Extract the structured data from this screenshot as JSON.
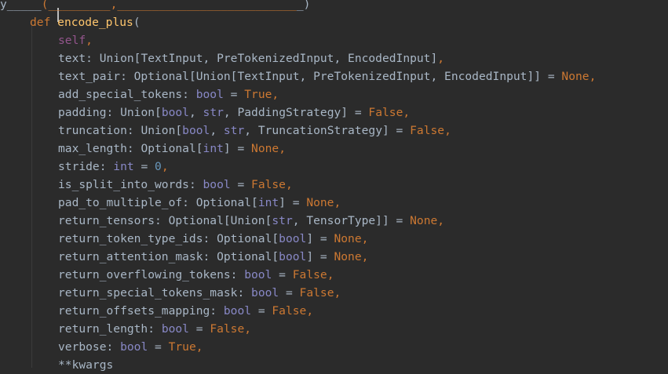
{
  "colors": {
    "background": "#2b2b2b",
    "text": "#a9b7c6",
    "keyword": "#cc7832",
    "function_name": "#ffc66d",
    "self": "#94558d",
    "builtin": "#8888c6",
    "number": "#6897bb"
  },
  "editor": {
    "lines": [
      {
        "indent": 0,
        "tokens": [
          [
            "y_____",
            ""
          ],
          [
            "(_________,",
            "t-kw"
          ],
          [
            "__________________________",
            "t-kw"
          ],
          [
            "_)",
            "t-punct"
          ]
        ]
      },
      {
        "indent": 1,
        "tokens": [
          [
            "def",
            "t-kw"
          ],
          [
            " ",
            ""
          ],
          [
            "encode_plus",
            "t-fn"
          ],
          [
            "(",
            "t-punct"
          ]
        ]
      },
      {
        "indent": 2,
        "tokens": [
          [
            "self",
            "t-self"
          ],
          [
            ",",
            "t-comma"
          ]
        ]
      },
      {
        "indent": 2,
        "tokens": [
          [
            "text",
            ""
          ],
          [
            ": Union[TextInput, PreTokenizedInput, EncodedInput]",
            ""
          ],
          [
            ",",
            "t-comma"
          ]
        ]
      },
      {
        "indent": 2,
        "tokens": [
          [
            "text_pair",
            ""
          ],
          [
            ": Optional[Union[TextInput, PreTokenizedInput, EncodedInput]] = ",
            ""
          ],
          [
            "None",
            "t-kw"
          ],
          [
            ",",
            "t-comma"
          ]
        ]
      },
      {
        "indent": 2,
        "tokens": [
          [
            "add_special_tokens",
            ""
          ],
          [
            ": ",
            ""
          ],
          [
            "bool",
            "t-builtin"
          ],
          [
            " = ",
            ""
          ],
          [
            "True",
            "t-kw"
          ],
          [
            ",",
            "t-comma"
          ]
        ]
      },
      {
        "indent": 2,
        "tokens": [
          [
            "padding",
            ""
          ],
          [
            ": Union[",
            ""
          ],
          [
            "bool",
            "t-builtin"
          ],
          [
            ", ",
            ""
          ],
          [
            "str",
            "t-builtin"
          ],
          [
            ", PaddingStrategy] = ",
            ""
          ],
          [
            "False",
            "t-kw"
          ],
          [
            ",",
            "t-comma"
          ]
        ]
      },
      {
        "indent": 2,
        "tokens": [
          [
            "truncation",
            ""
          ],
          [
            ": Union[",
            ""
          ],
          [
            "bool",
            "t-builtin"
          ],
          [
            ", ",
            ""
          ],
          [
            "str",
            "t-builtin"
          ],
          [
            ", TruncationStrategy] = ",
            ""
          ],
          [
            "False",
            "t-kw"
          ],
          [
            ",",
            "t-comma"
          ]
        ]
      },
      {
        "indent": 2,
        "tokens": [
          [
            "max_length",
            ""
          ],
          [
            ": Optional[",
            ""
          ],
          [
            "int",
            "t-builtin"
          ],
          [
            "] = ",
            ""
          ],
          [
            "None",
            "t-kw"
          ],
          [
            ",",
            "t-comma"
          ]
        ]
      },
      {
        "indent": 2,
        "tokens": [
          [
            "stride",
            ""
          ],
          [
            ": ",
            ""
          ],
          [
            "int",
            "t-builtin"
          ],
          [
            " = ",
            ""
          ],
          [
            "0",
            "t-num"
          ],
          [
            ",",
            "t-comma"
          ]
        ]
      },
      {
        "indent": 2,
        "tokens": [
          [
            "is_split_into_words",
            ""
          ],
          [
            ": ",
            ""
          ],
          [
            "bool",
            "t-builtin"
          ],
          [
            " = ",
            ""
          ],
          [
            "False",
            "t-kw"
          ],
          [
            ",",
            "t-comma"
          ]
        ]
      },
      {
        "indent": 2,
        "tokens": [
          [
            "pad_to_multiple_of",
            ""
          ],
          [
            ": Optional[",
            ""
          ],
          [
            "int",
            "t-builtin"
          ],
          [
            "] = ",
            ""
          ],
          [
            "None",
            "t-kw"
          ],
          [
            ",",
            "t-comma"
          ]
        ]
      },
      {
        "indent": 2,
        "tokens": [
          [
            "return_tensors",
            ""
          ],
          [
            ": Optional[Union[",
            ""
          ],
          [
            "str",
            "t-builtin"
          ],
          [
            ", TensorType]] = ",
            ""
          ],
          [
            "None",
            "t-kw"
          ],
          [
            ",",
            "t-comma"
          ]
        ]
      },
      {
        "indent": 2,
        "tokens": [
          [
            "return_token_type_ids",
            ""
          ],
          [
            ": Optional[",
            ""
          ],
          [
            "bool",
            "t-builtin"
          ],
          [
            "] = ",
            ""
          ],
          [
            "None",
            "t-kw"
          ],
          [
            ",",
            "t-comma"
          ]
        ]
      },
      {
        "indent": 2,
        "tokens": [
          [
            "return_attention_mask",
            ""
          ],
          [
            ": Optional[",
            ""
          ],
          [
            "bool",
            "t-builtin"
          ],
          [
            "] = ",
            ""
          ],
          [
            "None",
            "t-kw"
          ],
          [
            ",",
            "t-comma"
          ]
        ]
      },
      {
        "indent": 2,
        "tokens": [
          [
            "return_overflowing_tokens",
            ""
          ],
          [
            ": ",
            ""
          ],
          [
            "bool",
            "t-builtin"
          ],
          [
            " = ",
            ""
          ],
          [
            "False",
            "t-kw"
          ],
          [
            ",",
            "t-comma"
          ]
        ]
      },
      {
        "indent": 2,
        "tokens": [
          [
            "return_special_tokens_mask",
            ""
          ],
          [
            ": ",
            ""
          ],
          [
            "bool",
            "t-builtin"
          ],
          [
            " = ",
            ""
          ],
          [
            "False",
            "t-kw"
          ],
          [
            ",",
            "t-comma"
          ]
        ]
      },
      {
        "indent": 2,
        "tokens": [
          [
            "return_offsets_mapping",
            ""
          ],
          [
            ": ",
            ""
          ],
          [
            "bool",
            "t-builtin"
          ],
          [
            " = ",
            ""
          ],
          [
            "False",
            "t-kw"
          ],
          [
            ",",
            "t-comma"
          ]
        ]
      },
      {
        "indent": 2,
        "tokens": [
          [
            "return_length",
            ""
          ],
          [
            ": ",
            ""
          ],
          [
            "bool",
            "t-builtin"
          ],
          [
            " = ",
            ""
          ],
          [
            "False",
            "t-kw"
          ],
          [
            ",",
            "t-comma"
          ]
        ]
      },
      {
        "indent": 2,
        "tokens": [
          [
            "verbose",
            ""
          ],
          [
            ": ",
            ""
          ],
          [
            "bool",
            "t-builtin"
          ],
          [
            " = ",
            ""
          ],
          [
            "True",
            "t-kw"
          ],
          [
            ",",
            "t-comma"
          ]
        ]
      },
      {
        "indent": 2,
        "tokens": [
          [
            "**kwargs",
            ""
          ]
        ]
      }
    ]
  }
}
